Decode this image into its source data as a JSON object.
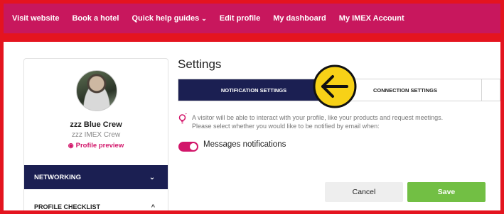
{
  "topnav": {
    "items": [
      {
        "label": "Visit website"
      },
      {
        "label": "Book a hotel"
      },
      {
        "label": "Quick help guides"
      },
      {
        "label": "Edit profile"
      },
      {
        "label": "My dashboard"
      },
      {
        "label": "My IMEX Account"
      }
    ],
    "dropdown_glyph": "⌄"
  },
  "profile": {
    "name": "zzz Blue Crew",
    "company": "zzz IMEX Crew",
    "preview_label": "Profile preview",
    "preview_icon": "eye-icon"
  },
  "sidebar": {
    "networking_label": "NETWORKING",
    "networking_chevron": "⌄",
    "checklist_label": "PROFILE CHECKLIST",
    "checklist_chevron": "^"
  },
  "settings": {
    "title": "Settings",
    "tabs": [
      {
        "label": "NOTIFICATION SETTINGS",
        "active": true
      },
      {
        "label": "CONNECTION SETTINGS",
        "active": false
      }
    ],
    "info_lines": [
      "A visitor will be able to interact with your profile, like your products and request meetings.",
      "Please select whether you would like to be notified by email when:"
    ],
    "toggle_label": "Messages notifications",
    "toggle_on": true
  },
  "actions": {
    "cancel_label": "Cancel",
    "save_label": "Save"
  },
  "colors": {
    "nav_bg": "#c8175d",
    "border_red": "#e4141f",
    "navy": "#1b1f52",
    "accent_pink": "#d2166a",
    "save_green": "#72bf44",
    "annotation_yellow": "#f7d117"
  },
  "annotation": {
    "icon": "back-arrow-icon"
  }
}
